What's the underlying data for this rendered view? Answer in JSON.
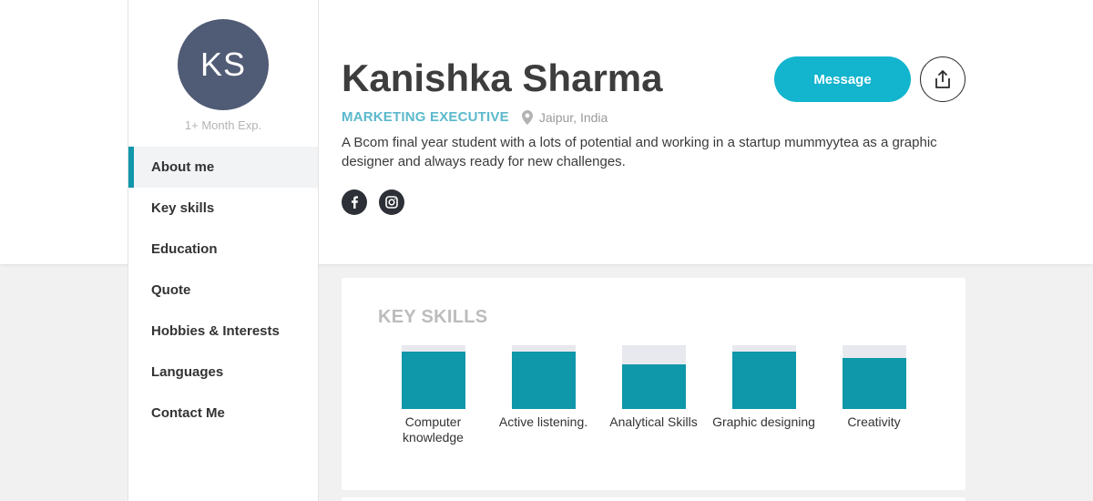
{
  "colors": {
    "accent": "#0f97aa",
    "message_button": "#12b4ce",
    "avatar_bg": "#505b75",
    "job_title": "#5bb9cc"
  },
  "profile": {
    "initials": "KS",
    "experience": "1+ Month Exp.",
    "name": "Kanishka Sharma",
    "job_title": "MARKETING EXECUTIVE",
    "location": "Jaipur, India",
    "bio": "A Bcom final year student with a lots of potential and working in a startup mummyytea as a graphic designer and always ready for new challenges.",
    "socials": [
      {
        "icon": "facebook-icon"
      },
      {
        "icon": "instagram-icon"
      }
    ]
  },
  "actions": {
    "message_label": "Message",
    "share_icon": "share-icon"
  },
  "sidebar": {
    "items": [
      {
        "label": "About me",
        "active": true
      },
      {
        "label": "Key skills",
        "active": false
      },
      {
        "label": "Education",
        "active": false
      },
      {
        "label": "Quote",
        "active": false
      },
      {
        "label": "Hobbies & Interests",
        "active": false
      },
      {
        "label": "Languages",
        "active": false
      },
      {
        "label": "Contact Me",
        "active": false
      }
    ]
  },
  "key_skills": {
    "heading": "KEY SKILLS",
    "skills": [
      {
        "label": "Computer knowledge",
        "level": 0.9
      },
      {
        "label": "Active listening.",
        "level": 0.9
      },
      {
        "label": "Analytical Skills",
        "level": 0.7
      },
      {
        "label": "Graphic designing",
        "level": 0.9
      },
      {
        "label": "Creativity",
        "level": 0.8
      }
    ]
  }
}
